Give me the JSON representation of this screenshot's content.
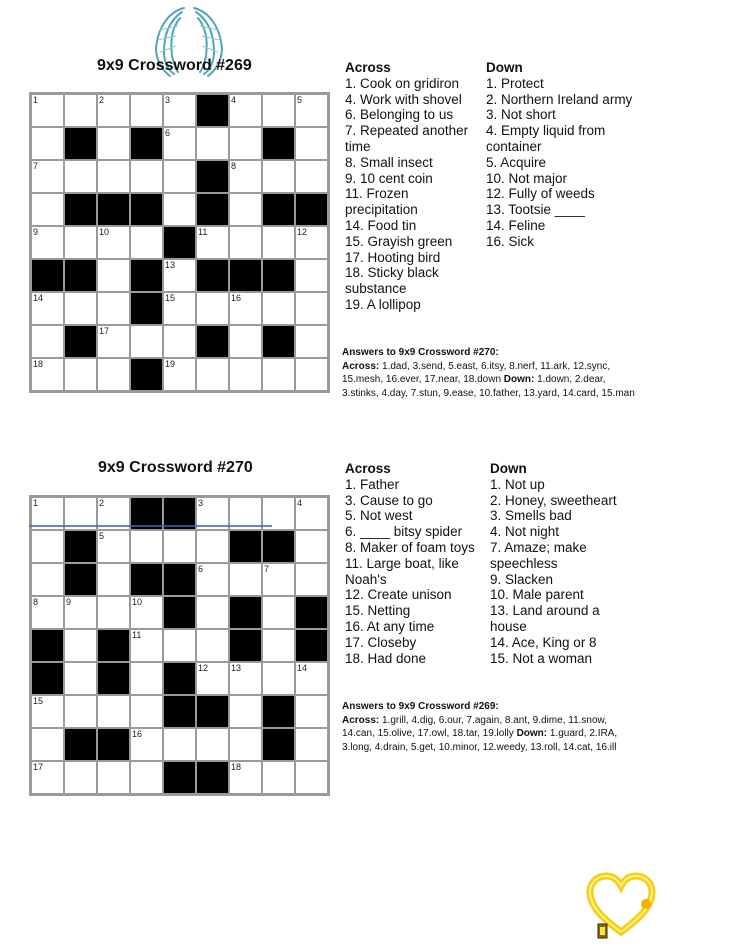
{
  "puzzles": [
    {
      "title": "9x9 Crossword #269",
      "grid": [
        [
          "1",
          "",
          "2",
          "",
          "3",
          "#",
          "4",
          "",
          "5"
        ],
        [
          "",
          "#",
          "",
          "#",
          "6",
          "",
          "",
          "#",
          ""
        ],
        [
          "7",
          "",
          "",
          "",
          "",
          "#",
          "8",
          "",
          ""
        ],
        [
          "",
          "#",
          "#",
          "#",
          "",
          "#",
          "",
          "#",
          "#"
        ],
        [
          "9",
          "",
          "10",
          "",
          "#",
          "11",
          "",
          "",
          "12"
        ],
        [
          "#",
          "#",
          "",
          "#",
          "13",
          "#",
          "#",
          "#",
          ""
        ],
        [
          "14",
          "",
          "",
          "#",
          "15",
          "",
          "16",
          "",
          ""
        ],
        [
          "",
          "#",
          "17",
          "",
          "",
          "#",
          "",
          "#",
          ""
        ],
        [
          "18",
          "",
          "",
          "#",
          "19",
          "",
          "",
          "",
          ""
        ]
      ],
      "across_label": "Across",
      "down_label": "Down",
      "across": [
        "1. Cook on gridiron",
        "4. Work with shovel",
        "6. Belonging to us",
        "7. Repeated another time",
        "8. Small insect",
        "9. 10 cent coin",
        "11. Frozen precipitation",
        "14. Food tin",
        "15. Grayish green",
        "17. Hooting bird",
        "18. Sticky black substance",
        "19. A lollipop"
      ],
      "down": [
        "1. Protect",
        "2. Northern Ireland army",
        "3. Not short",
        "4. Empty liquid from container",
        "5. Acquire",
        "10. Not major",
        "12. Fully of weeds",
        "13. Tootsie ____",
        "14. Feline",
        "16. Sick"
      ],
      "answers": {
        "title": "Answers to 9x9 Crossword #270:",
        "across_label": "Across:",
        "across_text": "1.dad, 3.send, 5.east, 6.itsy, 8.nerf, 11.ark, 12.sync, 15.mesh, 16.ever, 17.near, 18.down",
        "down_label": "Down:",
        "down_text": "1.down, 2.dear, 3.stinks, 4.day, 7.stun, 9.ease, 10.father, 13.yard, 14.card, 15.man"
      }
    },
    {
      "title": "9x9 Crossword #270",
      "grid": [
        [
          "1",
          "",
          "2",
          "#",
          "#",
          "3",
          "",
          "",
          "4"
        ],
        [
          "",
          "#",
          "5",
          "",
          "",
          "",
          "#",
          "#",
          ""
        ],
        [
          "",
          "#",
          "",
          "#",
          "#",
          "6",
          "",
          "7",
          ""
        ],
        [
          "8",
          "9",
          "",
          "10",
          "#",
          "",
          "#",
          "",
          "#"
        ],
        [
          "#",
          "",
          "#",
          "11",
          "",
          "",
          "#",
          "",
          "#"
        ],
        [
          "#",
          "",
          "#",
          "",
          "#",
          "12",
          "13",
          "",
          "14"
        ],
        [
          "15",
          "",
          "",
          "",
          "#",
          "#",
          "",
          "#",
          ""
        ],
        [
          "",
          "#",
          "#",
          "16",
          "",
          "",
          "",
          "#",
          ""
        ],
        [
          "17",
          "",
          "",
          "",
          "#",
          "#",
          "18",
          "",
          ""
        ]
      ],
      "across_label": "Across",
      "down_label": "Down",
      "across": [
        "1. Father",
        "3. Cause to go",
        "5. Not west",
        "6. ____ bitsy spider",
        "8. Maker of foam toys",
        "11. Large boat, like Noah's",
        "12. Create unison",
        "15. Netting",
        "16. At any time",
        "17. Closeby",
        "18. Had done"
      ],
      "down": [
        "1. Not up",
        "2. Honey, sweetheart",
        "3. Smells bad",
        "4. Not night",
        "7. Amaze; make speechless",
        "9. Slacken",
        "10. Male parent",
        "13. Land around a house",
        "14. Ace, King or 8",
        "15. Not a woman"
      ],
      "answers": {
        "title": "Answers to 9x9 Crossword #269:",
        "across_label": "Across:",
        "across_text": "1.grill, 4.dig, 6.our, 7.again, 8.ant, 9.dime, 11.snow, 14.can, 15.olive, 17.owl, 18.tar, 19.lolly",
        "down_label": "Down:",
        "down_text": "1.guard, 2.IRA, 3.long, 4.drain, 5.get, 10.minor, 12.weedy, 13.roll, 14.cat, 16.ill"
      }
    }
  ],
  "decorations": {
    "wings_icon": "angel-wings",
    "heart_icon": "golden-heart-lantern",
    "wing_color": "#4fa6b8",
    "heart_color": "#f5c800"
  }
}
